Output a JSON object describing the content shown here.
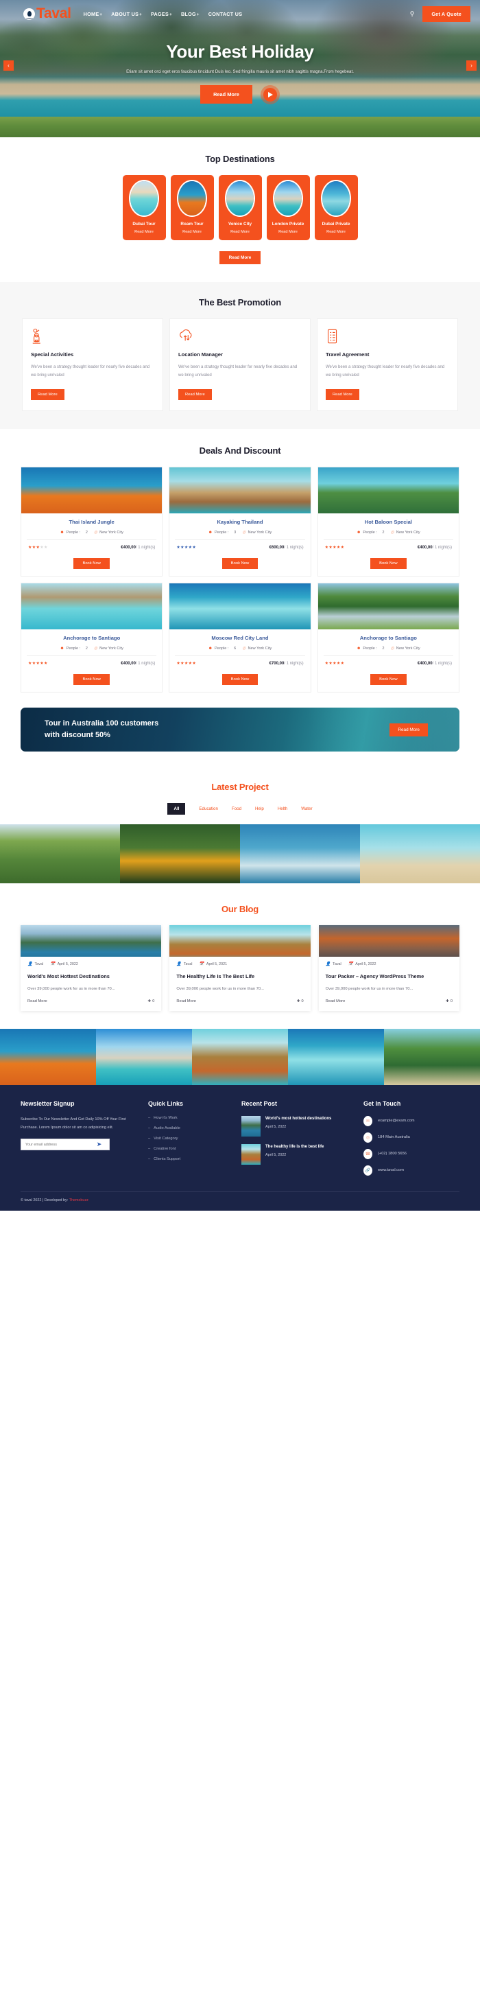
{
  "header": {
    "logo_text": "Taval",
    "logo_icon": "location-pin-icon",
    "nav": [
      {
        "label": "HOME",
        "caret": "+"
      },
      {
        "label": "ABOUT US",
        "caret": "+"
      },
      {
        "label": "PAGES",
        "caret": "+"
      },
      {
        "label": "BLOG",
        "caret": "+"
      },
      {
        "label": "CONTACT US",
        "caret": ""
      }
    ],
    "search_icon": "search-icon",
    "quote_button": "Get A Quote"
  },
  "hero": {
    "title": "Your Best Holiday",
    "subtitle": "Etiam sit amet orci eget eros faucibus tincidunt Duis leo. Sed fringilla mauris sit amet nibh sagittis magna.From hegebeat.",
    "read_more": "Read More",
    "play_icon": "play-icon",
    "prev_icon": "‹",
    "next_icon": "›"
  },
  "destinations": {
    "title": "Top Destinations",
    "items": [
      {
        "name": "Dubai Tour",
        "link": "Read More",
        "img": "img-maldives"
      },
      {
        "name": "Roam Tour",
        "link": "Read More",
        "img": "img-reef"
      },
      {
        "name": "Venice City",
        "link": "Read More",
        "img": "img-rocks"
      },
      {
        "name": "London Private",
        "link": "Read More",
        "img": "img-rocks"
      },
      {
        "name": "Dubai Private",
        "link": "Read More",
        "img": "img-island"
      }
    ],
    "more_button": "Read More"
  },
  "promotion": {
    "title": "The Best Promotion",
    "cards": [
      {
        "icon": "activities-person-icon",
        "title": "Special Activities",
        "text": "We've been a strategy thought leader for nearly five decades and we bring unrivaled",
        "button": "Read More"
      },
      {
        "icon": "cloud-sync-icon",
        "title": "Location Manager",
        "text": "We've been a strategy thought leader for nearly five decades and we bring unrivaled",
        "button": "Read More"
      },
      {
        "icon": "clipboard-list-icon",
        "title": "Travel Agreement",
        "text": "We've been a strategy thought leader for nearly five decades and we bring unrivaled",
        "button": "Read More"
      }
    ]
  },
  "deals": {
    "title": "Deals And Discount",
    "people_label": "People :",
    "location_label": "New York City",
    "unit_label": "/ 1 night(s)",
    "book_label": "Book Now",
    "items": [
      {
        "title": "Thai Island Jungle",
        "people": "2",
        "location": "New York City",
        "stars": 3,
        "star_color": "orange",
        "price": "€400,00",
        "unit": "/ 1 night(s)",
        "button": "Book Now",
        "img": "img-reef"
      },
      {
        "title": "Kayaking Thailand",
        "people": "3",
        "location": "New York City",
        "stars": 5,
        "star_color": "blue",
        "price": "€600,00",
        "unit": "/ 1 night(s)",
        "button": "Book Now",
        "img": "img-hut"
      },
      {
        "title": "Hot Baloon Special",
        "people": "2",
        "location": "New York City",
        "stars": 4.5,
        "star_color": "orange",
        "price": "€400,00",
        "unit": "/ 1 night(s)",
        "button": "Book Now",
        "img": "img-palm"
      },
      {
        "title": "Anchorage to Santiago",
        "people": "2",
        "location": "New York City",
        "stars": 4.5,
        "star_color": "orange",
        "price": "€400,00",
        "unit": "/ 1 night(s)",
        "button": "Book Now",
        "img": "img-bungalow"
      },
      {
        "title": "Moscow Red City Land",
        "people": "6",
        "location": "New York City",
        "stars": 4.5,
        "star_color": "orange",
        "price": "€700,00",
        "unit": "/ 1 night(s)",
        "button": "Book Now",
        "img": "img-lagoon"
      },
      {
        "title": "Anchorage to Santiago",
        "people": "2",
        "location": "New York City",
        "stars": 4.5,
        "star_color": "orange",
        "price": "€400,00",
        "unit": "/ 1 night(s)",
        "button": "Book Now",
        "img": "img-river"
      }
    ]
  },
  "cta": {
    "line1": "Tour in Australia 100 customers",
    "line2": "with discount 50%",
    "button": "Read More"
  },
  "projects": {
    "title": "Latest Project",
    "filters": [
      {
        "label": "All",
        "active": true
      },
      {
        "label": "Education",
        "active": false
      },
      {
        "label": "Food",
        "active": false
      },
      {
        "label": "Help",
        "active": false
      },
      {
        "label": "Helth",
        "active": false
      },
      {
        "label": "Water",
        "active": false
      }
    ],
    "images": [
      "img-valley",
      "img-toucan",
      "img-surf",
      "img-beachgirl"
    ]
  },
  "blog": {
    "title": "Our Blog",
    "author_icon": "user-icon",
    "date_icon": "calendar-icon",
    "posts": [
      {
        "author": "Taval",
        "date": "April 5, 2022",
        "title": "World's Most Hottest Destinations",
        "text": "Over 39,000 people work for us in more than 70...",
        "read_more": "Read More",
        "comments": "0",
        "img": "img-bled"
      },
      {
        "author": "Taval",
        "date": "April 5, 2021",
        "title": "The Healthy Life Is The Best Life",
        "text": "Over 39,000 people work for us in more than 70...",
        "read_more": "Read More",
        "comments": "0",
        "img": "img-gazebo"
      },
      {
        "author": "Taval",
        "date": "April 5, 2022",
        "title": "Tour Packer – Agency WordPress Theme",
        "text": "Over 39,000 people work for us in more than 70...",
        "read_more": "Read More",
        "comments": "0",
        "img": "img-yosemite"
      }
    ]
  },
  "strip": [
    "img-reef",
    "img-rocks",
    "img-gazebo",
    "img-lagoon",
    "img-tropic"
  ],
  "footer": {
    "newsletter": {
      "title": "Newsletter Signup",
      "text": "Subscribe To Our Newsletter And Get Daily 10% Off Your First Purchase. Lorem Ipsum dolor sit am co adipisicing elit.",
      "placeholder": "Your email address",
      "send_icon": "send-icon"
    },
    "quick_links": {
      "title": "Quick Links",
      "items": [
        "How it's Work",
        "Audio Available",
        "Visit Category",
        "Creative font",
        "Clients Support"
      ]
    },
    "recent_post": {
      "title": "Recent Post",
      "posts": [
        {
          "title": "World's most hottest destinations",
          "date": "April 5, 2022",
          "img": "img-bled"
        },
        {
          "title": "The healthy life is the best life",
          "date": "April 5, 2022",
          "img": "img-gazebo"
        }
      ]
    },
    "get_in_touch": {
      "title": "Get In Touch",
      "items": [
        {
          "icon": "envelope-icon",
          "text": "example@exam.com"
        },
        {
          "icon": "map-marker-icon",
          "text": "184 Main Australia"
        },
        {
          "icon": "phone-icon",
          "text": "(+02) 1800 5656"
        },
        {
          "icon": "link-icon",
          "text": "www.taval.com"
        }
      ]
    },
    "copyright_prefix": "© taval 2022 | Developed by: ",
    "copyright_brand": "Themebuzz"
  },
  "colors": {
    "accent": "#f4511e",
    "dark": "#1d1d2c",
    "footer_bg": "#1b2447",
    "blue": "#3b5a9a"
  }
}
